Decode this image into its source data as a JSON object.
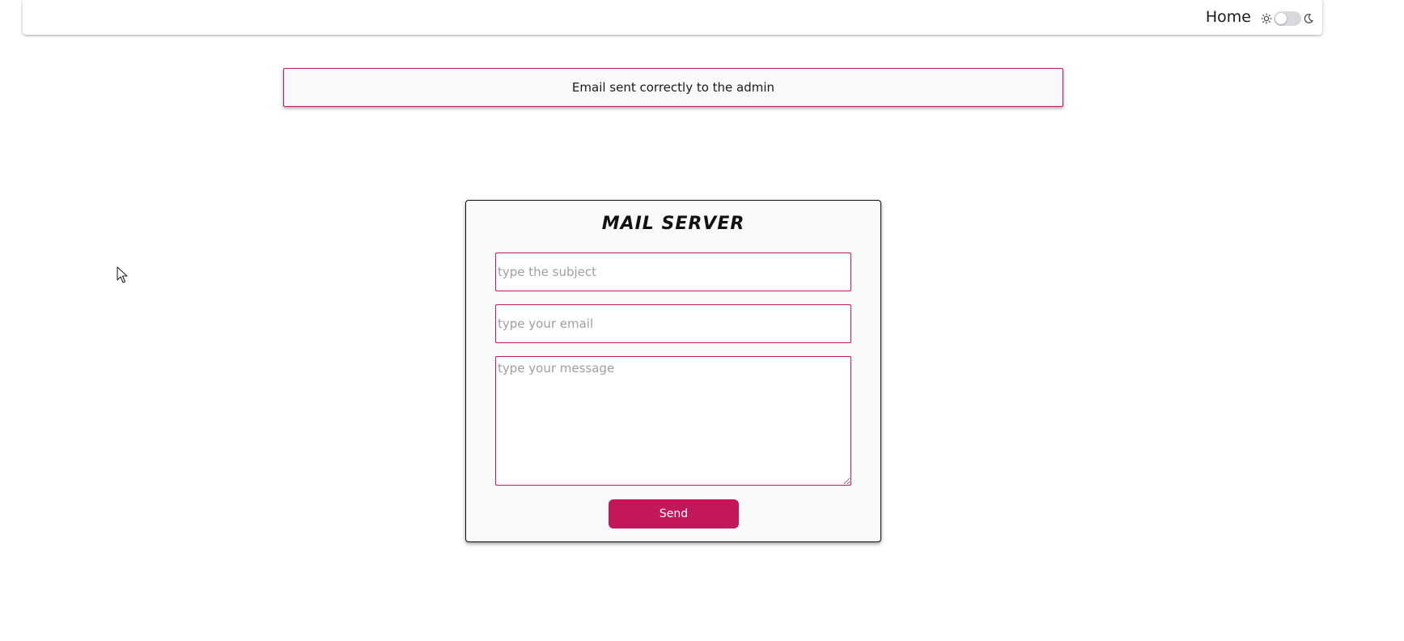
{
  "navbar": {
    "home_label": "Home",
    "theme_toggle": {
      "sun_icon": "sun-icon",
      "moon_icon": "moon-icon",
      "state": "light"
    }
  },
  "alert": {
    "message": "Email sent correctly to the admin"
  },
  "mail_form": {
    "title": "Mail Server",
    "subject_placeholder": "type the subject",
    "email_placeholder": "type your email",
    "message_placeholder": "type your message",
    "send_label": "Send"
  },
  "colors": {
    "accent": "#c2185b",
    "card_background": "#f8f9fb",
    "toggle_track": "#d7d9de"
  },
  "icons": {
    "cursor": "mouse-pointer-icon"
  }
}
